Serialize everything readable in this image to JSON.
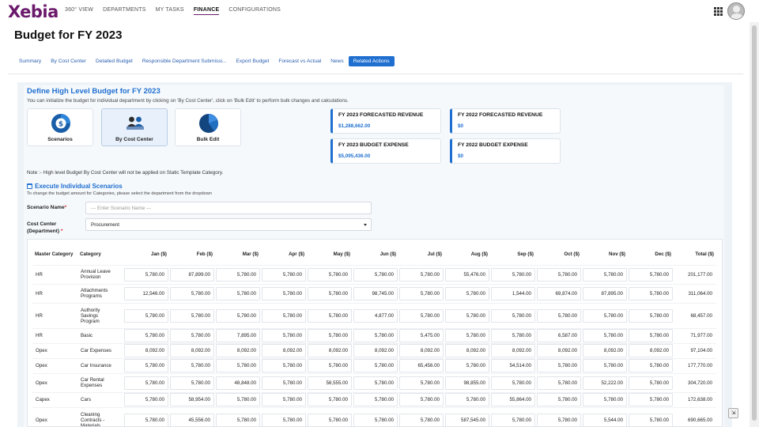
{
  "brand": "Xebia",
  "nav": [
    "360° VIEW",
    "DEPARTMENTS",
    "MY TASKS",
    "FINANCE",
    "CONFIGURATIONS"
  ],
  "nav_active": "FINANCE",
  "page_title": "Budget for FY 2023",
  "tabs": [
    "Summary",
    "By Cost Center",
    "Detailed Budget",
    "Responsible Department Submissi...",
    "Export Budget",
    "Forecast vs Actual",
    "News",
    "Related Actions"
  ],
  "tab_active": "Related Actions",
  "section": {
    "title": "Define High Level Budget for FY 2023",
    "subtitle": "You can initialize the budget for individual department by clicking on 'By Cost Center', click on 'Bulk Edit' to perform bulk changes and calculations."
  },
  "cards": [
    {
      "label": "Scenarios",
      "icon": "dollar-pie-icon"
    },
    {
      "label": "By Cost Center",
      "icon": "people-desk-icon"
    },
    {
      "label": "Bulk Edit",
      "icon": "pie-chart-icon"
    }
  ],
  "kpis": [
    {
      "title": "FY 2023 FORECASTED REVENUE",
      "value": "$1,288,662.00"
    },
    {
      "title": "FY 2022 FORECASTED REVENUE",
      "value": "$0"
    },
    {
      "title": "FY 2023 BUDGET EXPENSE",
      "value": "$5,095,436.00"
    },
    {
      "title": "FY 2022 BUDGET EXPENSE",
      "value": "$0"
    }
  ],
  "note": "Note :- High level Budget By Cost Center will not be applied on Static Template Category.",
  "scenarios": {
    "title": "Execute Individual Scenarios",
    "subtitle": "To change the budget amount for Categories, please select the department from the dropdown"
  },
  "form": {
    "scenario_label": "Scenario Name",
    "scenario_placeholder": "--- Enter Scenario Name ---",
    "cost_center_label_1": "Cost Center",
    "cost_center_label_2": "(Department)",
    "cost_center_value": "Procurement",
    "required_mark": "*"
  },
  "table": {
    "headers": [
      "Master Category",
      "Category",
      "Jan ($)",
      "Feb ($)",
      "Mar ($)",
      "Apr ($)",
      "May ($)",
      "Jun ($)",
      "Jul ($)",
      "Aug ($)",
      "Sep ($)",
      "Oct ($)",
      "Nov ($)",
      "Dec ($)",
      "Total ($)"
    ],
    "rows": [
      {
        "master": "HR",
        "category": [
          "Annual Leave",
          "Provision"
        ],
        "values": [
          "5,780.00",
          "87,899.00",
          "5,780.00",
          "5,780.00",
          "5,780.00",
          "5,780.00",
          "5,780.00",
          "55,476.00",
          "5,780.00",
          "5,780.00",
          "5,780.00",
          "5,780.00"
        ],
        "total": "201,177.00"
      },
      {
        "master": "HR",
        "category": [
          "Attachments",
          "Programs"
        ],
        "values": [
          "12,546.00",
          "5,780.00",
          "5,780.00",
          "5,780.00",
          "5,780.00",
          "98,745.00",
          "5,780.00",
          "5,780.00",
          "1,544.00",
          "69,874.00",
          "87,895.00",
          "5,780.00"
        ],
        "total": "311,064.00"
      },
      {
        "master": "HR",
        "category": [
          "Authority",
          "Savings",
          "Program"
        ],
        "values": [
          "5,780.00",
          "5,780.00",
          "5,780.00",
          "5,780.00",
          "5,780.00",
          "4,877.00",
          "5,780.00",
          "5,780.00",
          "5,780.00",
          "5,780.00",
          "5,780.00",
          "5,780.00"
        ],
        "total": "68,457.00"
      },
      {
        "master": "HR",
        "category": [
          "Basic"
        ],
        "values": [
          "5,780.00",
          "5,780.00",
          "7,895.00",
          "5,780.00",
          "5,780.00",
          "5,780.00",
          "5,475.00",
          "5,780.00",
          "5,780.00",
          "6,587.00",
          "5,780.00",
          "5,780.00"
        ],
        "total": "71,977.00"
      },
      {
        "master": "Opex",
        "category": [
          "Car Expenses"
        ],
        "values": [
          "8,092.00",
          "8,092.00",
          "8,092.00",
          "8,092.00",
          "8,092.00",
          "8,092.00",
          "8,092.00",
          "8,092.00",
          "8,092.00",
          "8,092.00",
          "8,092.00",
          "8,092.00"
        ],
        "total": "97,104.00"
      },
      {
        "master": "Opex",
        "category": [
          "Car Insurance"
        ],
        "values": [
          "5,780.00",
          "5,780.00",
          "5,780.00",
          "5,780.00",
          "5,780.00",
          "5,780.00",
          "65,456.00",
          "5,780.00",
          "54,514.00",
          "5,780.00",
          "5,780.00",
          "5,780.00"
        ],
        "total": "177,770.00"
      },
      {
        "master": "Opex",
        "category": [
          "Car Rental",
          "Expenses"
        ],
        "values": [
          "5,780.00",
          "5,780.00",
          "48,848.00",
          "5,780.00",
          "58,555.00",
          "5,780.00",
          "5,780.00",
          "98,855.00",
          "5,780.00",
          "5,780.00",
          "52,222.00",
          "5,780.00"
        ],
        "total": "304,720.00"
      },
      {
        "master": "Capex",
        "category": [
          "Cars"
        ],
        "values": [
          "5,780.00",
          "58,954.00",
          "5,780.00",
          "5,780.00",
          "5,780.00",
          "5,780.00",
          "5,780.00",
          "5,780.00",
          "55,864.00",
          "5,780.00",
          "5,780.00",
          "5,780.00"
        ],
        "total": "172,638.00"
      },
      {
        "master": "Opex",
        "category": [
          "Cleaning",
          "Contracts -",
          "Materials"
        ],
        "values": [
          "5,780.00",
          "45,556.00",
          "5,780.00",
          "5,780.00",
          "5,780.00",
          "5,780.00",
          "5,780.00",
          "587,545.00",
          "5,780.00",
          "5,780.00",
          "5,544.00",
          "5,780.00"
        ],
        "total": "690,665.00"
      }
    ]
  }
}
